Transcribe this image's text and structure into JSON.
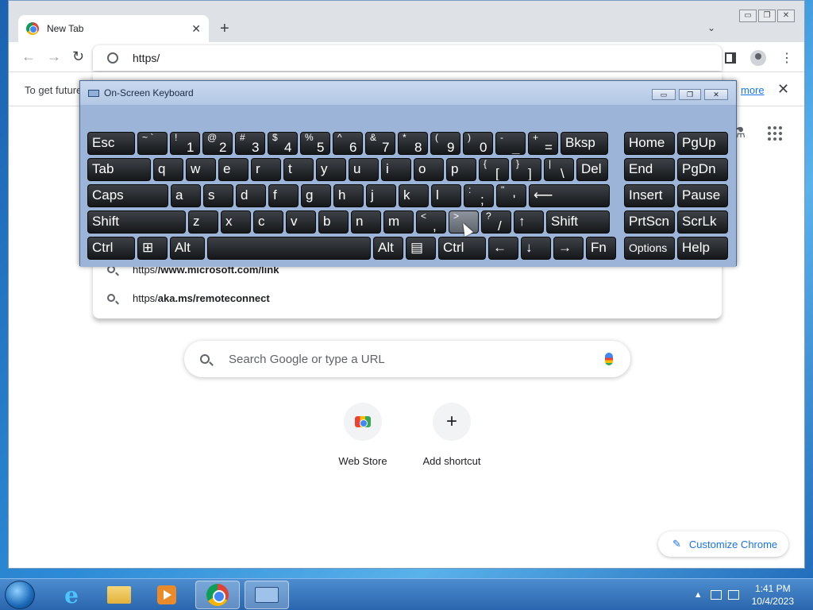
{
  "browser": {
    "tab_title": "New Tab",
    "tab_close": "✕",
    "new_tab": "+",
    "tab_menu": "⌄",
    "address_value": "https/",
    "infobar_message": "To get future",
    "infobar_link": "more",
    "infobar_close": "✕",
    "window_buttons": [
      "▭",
      "❐",
      "✕"
    ]
  },
  "suggestions": [
    {
      "prefix": "https/",
      "bold": "/www.microsoft.com/link"
    },
    {
      "prefix": "https/",
      "bold": "aka.ms/remoteconnect"
    }
  ],
  "ntp": {
    "search_placeholder": "Search Google or type a URL",
    "shortcuts": [
      {
        "label": "Web Store",
        "icon": "webstore-icon"
      },
      {
        "label": "Add shortcut",
        "icon": "plus-icon",
        "glyph": "+"
      }
    ],
    "customize_label": "Customize Chrome"
  },
  "osk": {
    "title": "On-Screen Keyboard",
    "rows": [
      [
        {
          "t": "",
          "b": "Esc"
        },
        {
          "t": "~ `",
          "b": ""
        },
        {
          "t": "!",
          "b": "1"
        },
        {
          "t": "@",
          "b": "2"
        },
        {
          "t": "#",
          "b": "3"
        },
        {
          "t": "$",
          "b": "4"
        },
        {
          "t": "%",
          "b": "5"
        },
        {
          "t": "^",
          "b": "6"
        },
        {
          "t": "&",
          "b": "7"
        },
        {
          "t": "*",
          "b": "8"
        },
        {
          "t": "(",
          "b": "9"
        },
        {
          "t": ")",
          "b": "0"
        },
        {
          "t": "-",
          "b": "_"
        },
        {
          "t": "+",
          "b": "="
        },
        {
          "t": "",
          "b": "Bksp"
        },
        {
          "t": "",
          "b": "Home"
        },
        {
          "t": "",
          "b": "PgUp"
        }
      ],
      [
        {
          "t": "",
          "b": "Tab"
        },
        {
          "t": "",
          "b": "q"
        },
        {
          "t": "",
          "b": "w"
        },
        {
          "t": "",
          "b": "e"
        },
        {
          "t": "",
          "b": "r"
        },
        {
          "t": "",
          "b": "t"
        },
        {
          "t": "",
          "b": "y"
        },
        {
          "t": "",
          "b": "u"
        },
        {
          "t": "",
          "b": "i"
        },
        {
          "t": "",
          "b": "o"
        },
        {
          "t": "",
          "b": "p"
        },
        {
          "t": "{",
          "b": "["
        },
        {
          "t": "}",
          "b": "]"
        },
        {
          "t": "|",
          "b": "\\"
        },
        {
          "t": "",
          "b": "Del"
        },
        {
          "t": "",
          "b": "End"
        },
        {
          "t": "",
          "b": "PgDn"
        }
      ],
      [
        {
          "t": "",
          "b": "Caps"
        },
        {
          "t": "",
          "b": "a"
        },
        {
          "t": "",
          "b": "s"
        },
        {
          "t": "",
          "b": "d"
        },
        {
          "t": "",
          "b": "f"
        },
        {
          "t": "",
          "b": "g"
        },
        {
          "t": "",
          "b": "h"
        },
        {
          "t": "",
          "b": "j"
        },
        {
          "t": "",
          "b": "k"
        },
        {
          "t": "",
          "b": "l"
        },
        {
          "t": ":",
          "b": ";"
        },
        {
          "t": "\"",
          "b": "'"
        },
        {
          "t": "",
          "b": "⟵"
        },
        {
          "t": "",
          "b": "Insert"
        },
        {
          "t": "",
          "b": "Pause"
        }
      ],
      [
        {
          "t": "",
          "b": "Shift"
        },
        {
          "t": "",
          "b": "z"
        },
        {
          "t": "",
          "b": "x"
        },
        {
          "t": "",
          "b": "c"
        },
        {
          "t": "",
          "b": "v"
        },
        {
          "t": "",
          "b": "b"
        },
        {
          "t": "",
          "b": "n"
        },
        {
          "t": "",
          "b": "m"
        },
        {
          "t": "<",
          "b": ","
        },
        {
          "t": ">",
          "b": "."
        },
        {
          "t": "?",
          "b": "/"
        },
        {
          "t": "",
          "b": "↑"
        },
        {
          "t": "",
          "b": "Shift"
        },
        {
          "t": "",
          "b": "PrtScn"
        },
        {
          "t": "",
          "b": "ScrLk"
        }
      ],
      [
        {
          "t": "",
          "b": "Ctrl"
        },
        {
          "t": "",
          "b": "⊞"
        },
        {
          "t": "",
          "b": "Alt"
        },
        {
          "t": "",
          "b": ""
        },
        {
          "t": "",
          "b": "Alt"
        },
        {
          "t": "",
          "b": "▤"
        },
        {
          "t": "",
          "b": "Ctrl"
        },
        {
          "t": "",
          "b": "←"
        },
        {
          "t": "",
          "b": "↓"
        },
        {
          "t": "",
          "b": "→"
        },
        {
          "t": "",
          "b": "Fn"
        },
        {
          "t": "",
          "b": "Options"
        },
        {
          "t": "",
          "b": "Help"
        }
      ]
    ],
    "highlighted_key": "."
  },
  "taskbar": {
    "time": "1:41 PM",
    "date": "10/4/2023"
  }
}
